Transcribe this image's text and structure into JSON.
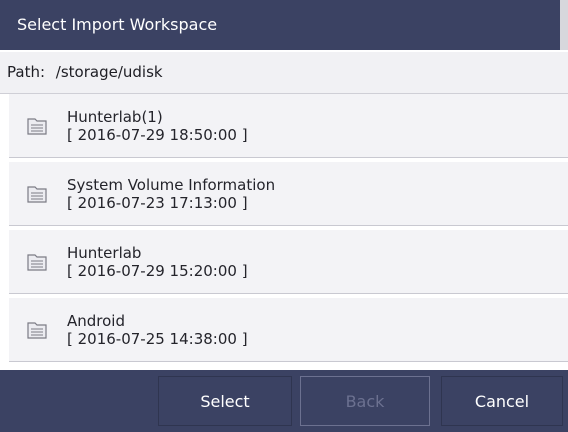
{
  "dialog": {
    "title": "Select Import Workspace",
    "path_prefix": "Path:",
    "path_value": "/storage/udisk"
  },
  "files": [
    {
      "name": "Hunterlab(1)",
      "date": "[ 2016-07-29 18:50:00 ]",
      "icon": "folder-icon"
    },
    {
      "name": "System Volume Information",
      "date": "[ 2016-07-23 17:13:00 ]",
      "icon": "folder-icon"
    },
    {
      "name": "Hunterlab",
      "date": "[ 2016-07-29 15:20:00 ]",
      "icon": "folder-icon"
    },
    {
      "name": "Android",
      "date": "[ 2016-07-25 14:38:00 ]",
      "icon": "folder-icon"
    }
  ],
  "buttons": {
    "select_label": "Select",
    "back_label": "Back",
    "cancel_label": "Cancel"
  },
  "colors": {
    "header_bg": "#3b4263",
    "row_bg": "#f3f3f6",
    "disabled_text": "#6c7190"
  }
}
